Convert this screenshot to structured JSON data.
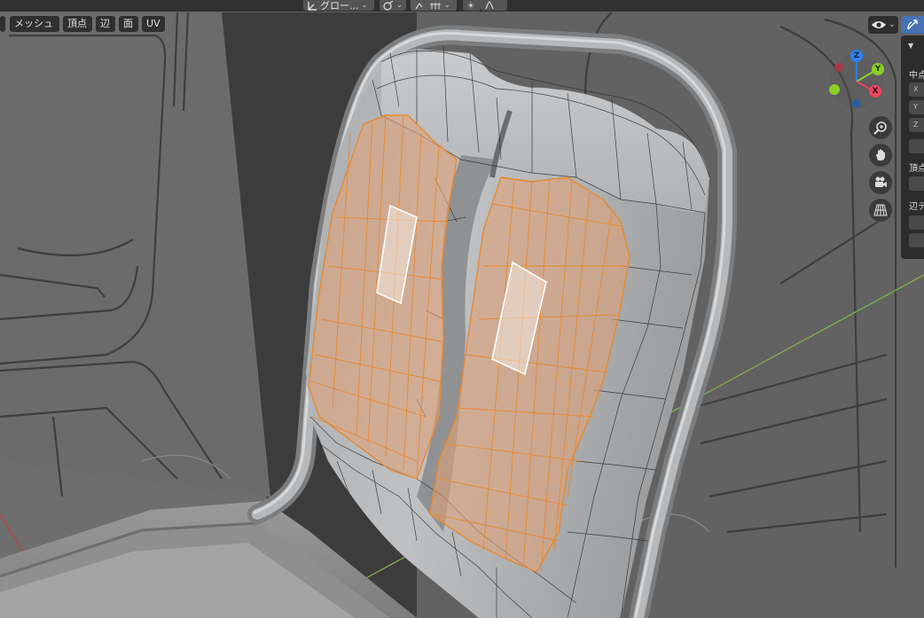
{
  "colors": {
    "background": "#5f5f5f",
    "header": "#303030",
    "selection_face": "#e0a27a",
    "selection_edge": "#e8892f",
    "axis_x": "#f0435d",
    "axis_y": "#8ccf27",
    "axis_z": "#2b82f0",
    "x_axis_line": "#7fb04a",
    "y_axis_line": "#c83d3d"
  },
  "header": {
    "transform_orientation": "グロー..."
  },
  "menu": [
    "メッシュ",
    "頂点",
    "辺",
    "面",
    "UV"
  ],
  "gizmo": {
    "x": "X",
    "y": "Y",
    "z": "Z"
  },
  "side_panel": {
    "section_median": "中点",
    "section_vertex": "頂点",
    "section_edge": "辺デ",
    "field_x": "X",
    "field_y": "Y",
    "field_z": "Z"
  },
  "icons": {
    "header": [
      "transform-orientation-icon",
      "pivot-icon",
      "snap-icon",
      "proportional-icon",
      "falloff-icon"
    ],
    "overlay": [
      "eye-icon",
      "gizmo-toggle-icon"
    ],
    "navigation": [
      "zoom-icon",
      "hand-pan-icon",
      "camera-icon",
      "grid-perspective-icon"
    ]
  }
}
